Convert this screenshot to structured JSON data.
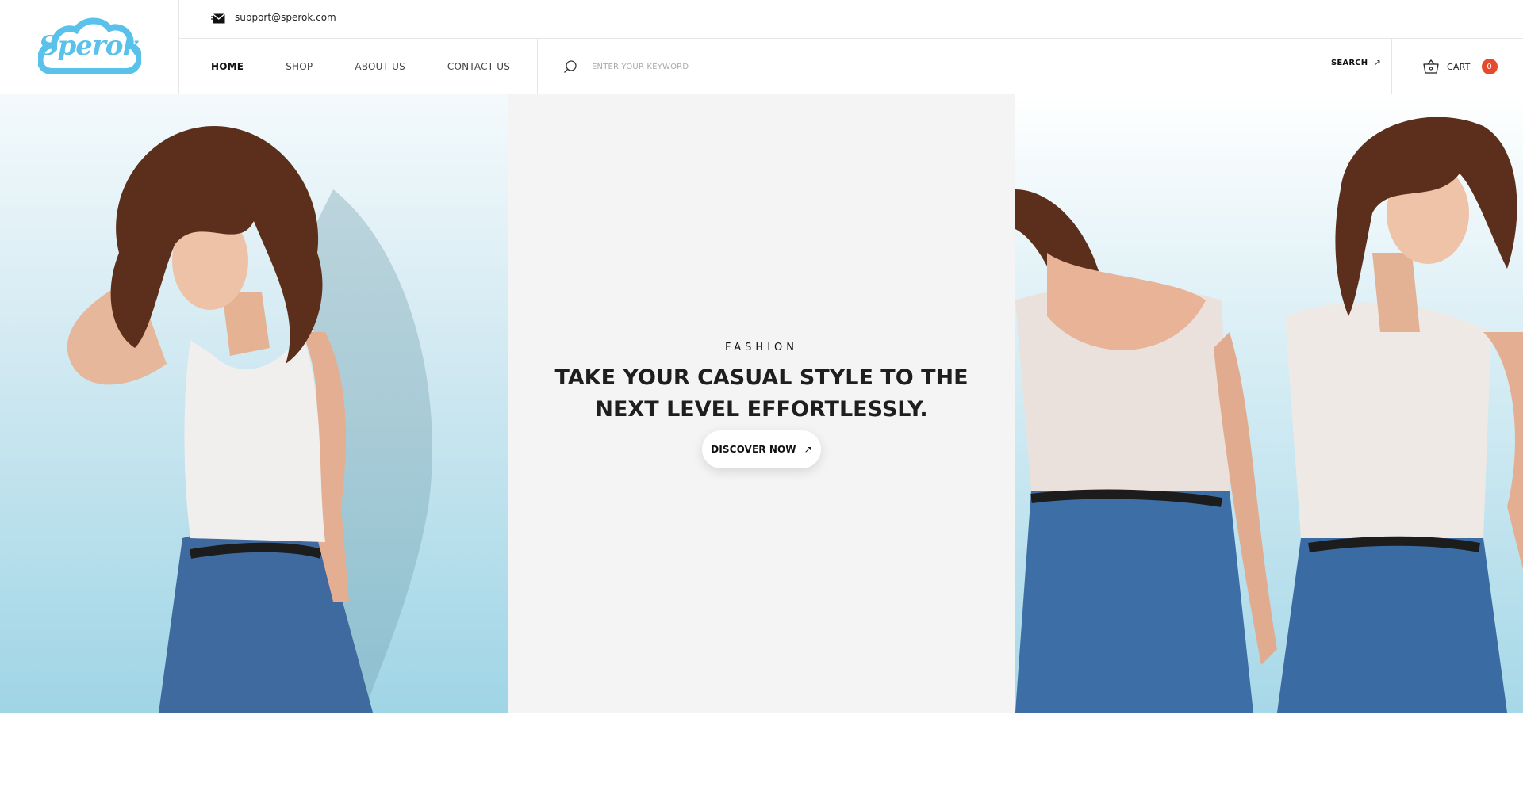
{
  "brand": {
    "logo_text": "Sperok",
    "color": "#59c1ea"
  },
  "topbar": {
    "email": "support@sperok.com",
    "icon": "mail-icon"
  },
  "nav": {
    "items": [
      {
        "label": "HOME",
        "active": true
      },
      {
        "label": "SHOP",
        "active": false
      },
      {
        "label": "ABOUT US",
        "active": false
      },
      {
        "label": "CONTACT US",
        "active": false
      }
    ]
  },
  "search": {
    "placeholder": "ENTER YOUR KEYWORD",
    "value": "",
    "button_label": "SEARCH",
    "button_icon": "arrow-up-right-icon"
  },
  "cart": {
    "label": "CART",
    "count": "0",
    "icon": "basket-icon",
    "badge_color": "#e64a2e"
  },
  "hero": {
    "kicker": "FASHION",
    "title": "TAKE YOUR CASUAL STYLE TO THE NEXT LEVEL EFFORTLESSLY.",
    "button_label": "DISCOVER NOW",
    "button_icon": "arrow-up-right-icon"
  }
}
